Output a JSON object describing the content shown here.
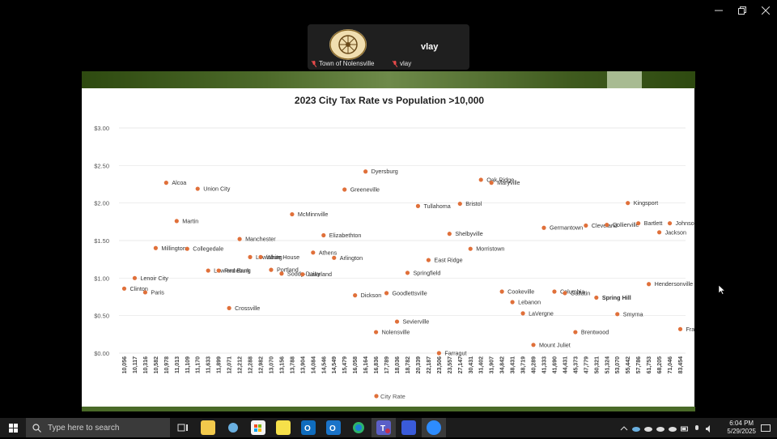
{
  "meeting": {
    "participants": [
      {
        "label": "Town of Nolensville"
      },
      {
        "label": "vlay",
        "display_name": "vlay"
      }
    ]
  },
  "chart_data": {
    "type": "scatter",
    "title": "2023 City Tax Rate vs Population >10,000",
    "legend": "City Rate",
    "legend_position": "bottom",
    "grid": true,
    "ylim": [
      0,
      3
    ],
    "yticks": [
      "$0.00",
      "$0.50",
      "$1.00",
      "$1.50",
      "$2.00",
      "$2.50",
      "$3.00"
    ],
    "categories": [
      "10,056",
      "10,117",
      "10,316",
      "10,582",
      "10,978",
      "11,013",
      "11,109",
      "11,170",
      "11,633",
      "11,899",
      "12,071",
      "12,212",
      "12,288",
      "12,982",
      "13,070",
      "13,156",
      "13,788",
      "13,904",
      "14,084",
      "14,546",
      "14,549",
      "15,479",
      "16,058",
      "16,164",
      "16,836",
      "17,789",
      "18,036",
      "18,782",
      "20,339",
      "22,187",
      "23,506",
      "23,557",
      "27,147",
      "30,431",
      "31,402",
      "31,907",
      "34,842",
      "38,431",
      "38,719",
      "40,289",
      "41,333",
      "41,690",
      "44,431",
      "45,373",
      "47,779",
      "50,321",
      "51,324",
      "53,070",
      "55,442",
      "57,786",
      "61,753",
      "68,205",
      "71,046",
      "83,454"
    ],
    "points": [
      {
        "cat": 0,
        "value": 0.86,
        "label": "Clinton"
      },
      {
        "cat": 1,
        "value": 1.0,
        "label": "Lenoir City"
      },
      {
        "cat": 2,
        "value": 0.81,
        "label": "Paris"
      },
      {
        "cat": 3,
        "value": 1.4,
        "label": "Millington"
      },
      {
        "cat": 4,
        "value": 2.27,
        "label": "Alcoa"
      },
      {
        "cat": 5,
        "value": 1.76,
        "label": "Martin"
      },
      {
        "cat": 6,
        "value": 1.39,
        "label": "Collegedale"
      },
      {
        "cat": 7,
        "value": 2.19,
        "label": "Union City"
      },
      {
        "cat": 8,
        "value": 1.1,
        "label": "Lawrenceburg"
      },
      {
        "cat": 9,
        "value": 1.1,
        "label": "Red Bank"
      },
      {
        "cat": 10,
        "value": 0.6,
        "label": "Crossville"
      },
      {
        "cat": 11,
        "value": 1.52,
        "label": "Manchester"
      },
      {
        "cat": 12,
        "value": 1.28,
        "label": "Lewisburg"
      },
      {
        "cat": 13,
        "value": 1.28,
        "label": "White House"
      },
      {
        "cat": 14,
        "value": 1.11,
        "label": "Portland"
      },
      {
        "cat": 15,
        "value": 1.06,
        "label": "Soddy-Daisy"
      },
      {
        "cat": 16,
        "value": 1.85,
        "label": "McMinnville"
      },
      {
        "cat": 17,
        "value": 1.05,
        "label": "Lakeland"
      },
      {
        "cat": 18,
        "value": 1.34,
        "label": "Athens"
      },
      {
        "cat": 19,
        "value": 1.57,
        "label": "Elizabethton"
      },
      {
        "cat": 20,
        "value": 1.27,
        "label": "Arlington"
      },
      {
        "cat": 21,
        "value": 2.18,
        "label": "Greeneville"
      },
      {
        "cat": 22,
        "value": 0.77,
        "label": "Dickson"
      },
      {
        "cat": 23,
        "value": 2.42,
        "label": "Dyersburg"
      },
      {
        "cat": 24,
        "value": 0.28,
        "label": "Nolensville"
      },
      {
        "cat": 25,
        "value": 0.8,
        "label": "Goodlettsville"
      },
      {
        "cat": 26,
        "value": 0.42,
        "label": "Sevierville"
      },
      {
        "cat": 27,
        "value": 1.07,
        "label": "Springfield"
      },
      {
        "cat": 28,
        "value": 1.96,
        "label": "Tullahoma"
      },
      {
        "cat": 29,
        "value": 1.24,
        "label": "East Ridge"
      },
      {
        "cat": 30,
        "value": 0.0,
        "label": "Farragut"
      },
      {
        "cat": 31,
        "value": 1.59,
        "label": "Shelbyville"
      },
      {
        "cat": 32,
        "value": 1.99,
        "label": "Bristol"
      },
      {
        "cat": 33,
        "value": 1.39,
        "label": "Morristown"
      },
      {
        "cat": 34,
        "value": 2.31,
        "label": "Oak Ridge"
      },
      {
        "cat": 35,
        "value": 2.27,
        "label": "Maryville"
      },
      {
        "cat": 36,
        "value": 0.82,
        "label": "Cookeville"
      },
      {
        "cat": 37,
        "value": 0.68,
        "label": "Lebanon"
      },
      {
        "cat": 38,
        "value": 0.53,
        "label": "LaVergne"
      },
      {
        "cat": 39,
        "value": 0.11,
        "label": "Mount Juliet"
      },
      {
        "cat": 40,
        "value": 1.67,
        "label": "Germantown"
      },
      {
        "cat": 41,
        "value": 0.82,
        "label": "Columbia"
      },
      {
        "cat": 42,
        "value": 0.8,
        "label": "Gallatin"
      },
      {
        "cat": 43,
        "value": 0.28,
        "label": "Brentwood"
      },
      {
        "cat": 44,
        "value": 1.7,
        "label": "Cleveland"
      },
      {
        "cat": 45,
        "value": 0.74,
        "label": "Spring Hill"
      },
      {
        "cat": 46,
        "value": 1.71,
        "label": "Collierville"
      },
      {
        "cat": 47,
        "value": 0.52,
        "label": "Smyrna"
      },
      {
        "cat": 48,
        "value": 2.0,
        "label": "Kingsport"
      },
      {
        "cat": 49,
        "value": 1.73,
        "label": "Bartlett"
      },
      {
        "cat": 50,
        "value": 0.92,
        "label": "Hendersonville"
      },
      {
        "cat": 51,
        "value": 1.61,
        "label": "Jackson"
      },
      {
        "cat": 52,
        "value": 1.73,
        "label": "Johnson City"
      },
      {
        "cat": 53,
        "value": 0.32,
        "label": "Franklin"
      }
    ],
    "marker_color": "#e0703a"
  },
  "taskbar": {
    "search_placeholder": "Type here to search",
    "time": "6:04 PM",
    "date": "5/29/2025"
  }
}
